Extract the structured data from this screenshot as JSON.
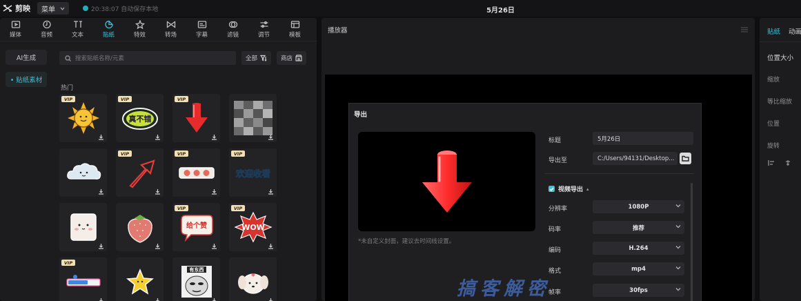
{
  "topbar": {
    "app_name": "剪映",
    "menu_label": "菜单",
    "autosave_text": "20:38:07 自动保存本地",
    "project_title": "5月26日"
  },
  "tool_tabs": [
    {
      "label": "媒体",
      "icon": "media-icon"
    },
    {
      "label": "音频",
      "icon": "audio-icon"
    },
    {
      "label": "文本",
      "icon": "text-icon"
    },
    {
      "label": "贴纸",
      "icon": "sticker-icon",
      "active": true
    },
    {
      "label": "特效",
      "icon": "effects-icon"
    },
    {
      "label": "转场",
      "icon": "transition-icon"
    },
    {
      "label": "字幕",
      "icon": "subtitle-icon"
    },
    {
      "label": "滤镜",
      "icon": "filter-icon"
    },
    {
      "label": "调节",
      "icon": "adjust-icon"
    },
    {
      "label": "模板",
      "icon": "template-icon"
    }
  ],
  "sidebar": {
    "ai_generate": "AI生成",
    "sticker_material": "• 贴纸素材"
  },
  "search": {
    "placeholder": "搜索贴纸名称/元素"
  },
  "filter_all": "全部",
  "store_label": "商店",
  "section_title": "热门",
  "stickers": [
    {
      "name": "sun",
      "vip": true,
      "desc": "sun"
    },
    {
      "name": "true-words",
      "vip": true,
      "text": "真不错"
    },
    {
      "name": "red-arrow",
      "vip": true
    },
    {
      "name": "mosaic",
      "vip": false
    },
    {
      "name": "cloud",
      "vip": false
    },
    {
      "name": "outline-arrow",
      "vip": true
    },
    {
      "name": "faces-banner",
      "vip": true
    },
    {
      "name": "welcome",
      "vip": true,
      "text": "欢迎收看"
    },
    {
      "name": "tofu",
      "vip": false
    },
    {
      "name": "strawberry",
      "vip": false
    },
    {
      "name": "like-bubble",
      "vip": true,
      "text": "给个赞"
    },
    {
      "name": "wow",
      "vip": true,
      "text": "WOW"
    },
    {
      "name": "progress-bar",
      "vip": true
    },
    {
      "name": "star",
      "vip": false
    },
    {
      "name": "meme",
      "vip": false,
      "text": "有东西"
    },
    {
      "name": "puppy",
      "vip": false
    }
  ],
  "vip_label": "VIP",
  "player": {
    "title": "播放器"
  },
  "right_panel": {
    "tab_sticker": "贴纸",
    "tab_animation": "动画",
    "position_size": "位置大小",
    "scale": "缩放",
    "uniform_scale": "等比缩放",
    "position": "位置",
    "rotation": "旋转"
  },
  "export_dialog": {
    "title": "导出",
    "cover_note": "*未自定义封面，建议去时间线设置。",
    "title_label": "标题",
    "title_value": "5月26日",
    "export_to_label": "导出至",
    "export_to_value": "C:/Users/94131/Desktop...",
    "video_export_label": "视频导出",
    "resolution_label": "分辨率",
    "resolution_value": "1080P",
    "bitrate_label": "码率",
    "bitrate_value": "推荐",
    "codec_label": "编码",
    "codec_value": "H.264",
    "format_label": "格式",
    "format_value": "mp4",
    "framerate_label": "帧率",
    "framerate_value": "30fps"
  },
  "watermark": "搞客解密",
  "colors": {
    "accent": "#3fc1d6",
    "sticker_red": "#e52b2b",
    "background": "#0f0f10"
  }
}
